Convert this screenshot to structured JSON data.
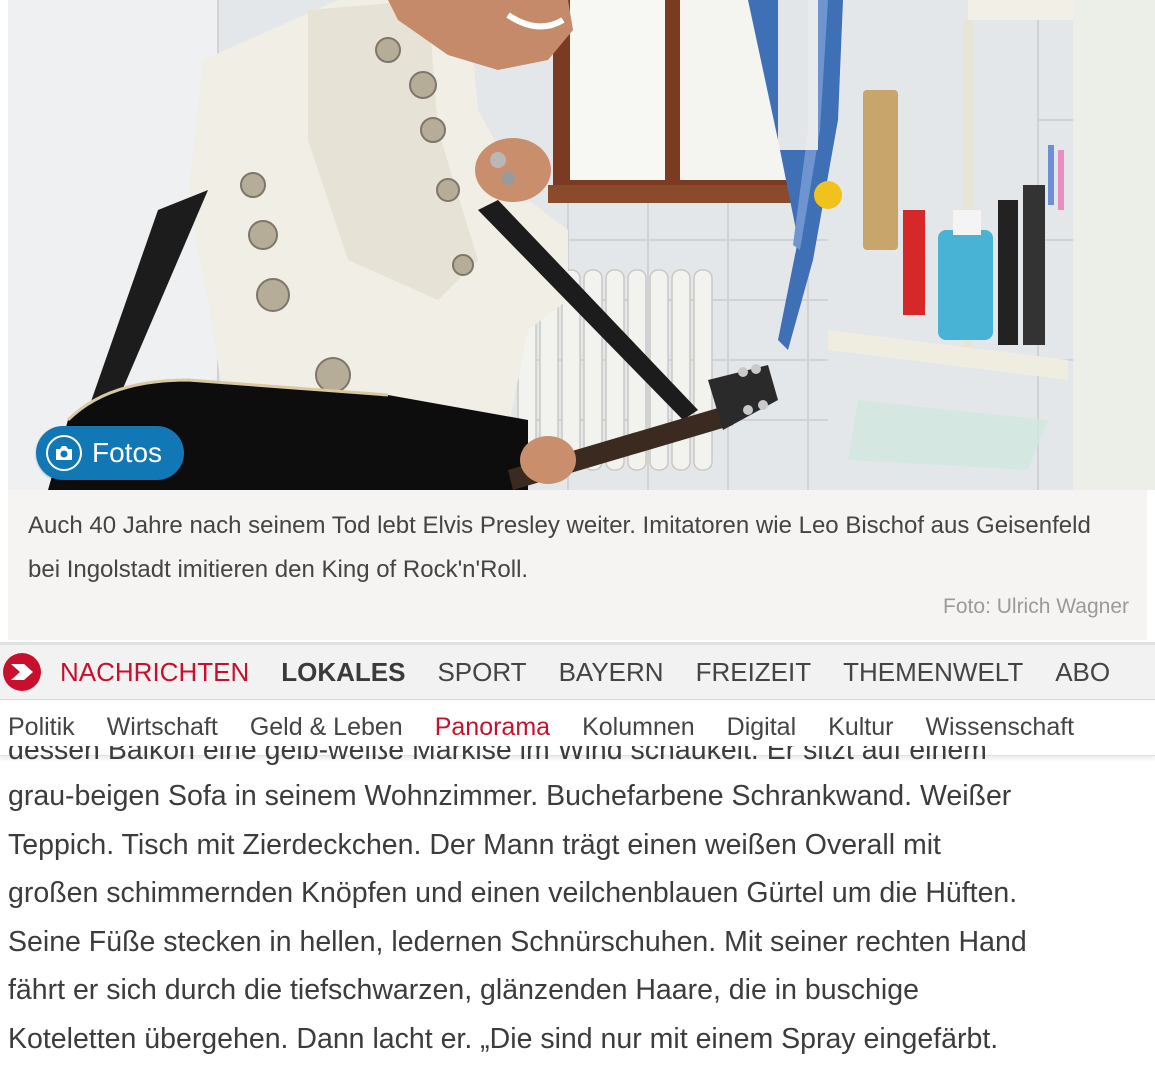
{
  "photo": {
    "alt_subject": "",
    "fotos_button_label": "Fotos",
    "icon": "camera-icon"
  },
  "caption": {
    "text": "Auch 40 Jahre nach seinem Tod lebt Elvis Presley weiter. Imitatoren wie Leo Bischof aus Geisenfeld bei Ingolstadt imitieren den King of Rock'n'Roll.",
    "credit": "Foto: Ulrich Wagner"
  },
  "nav_main": {
    "items": [
      {
        "label": "NACHRICHTEN",
        "state": "active"
      },
      {
        "label": "LOKALES",
        "state": "bold"
      },
      {
        "label": "SPORT",
        "state": ""
      },
      {
        "label": "BAYERN",
        "state": ""
      },
      {
        "label": "FREIZEIT",
        "state": ""
      },
      {
        "label": "THEMENWELT",
        "state": ""
      },
      {
        "label": "ABO",
        "state": ""
      }
    ],
    "logo_icon": "brand-arrow-logo-icon",
    "accent_color": "#c8102e"
  },
  "nav_sub": {
    "items": [
      {
        "label": "Politik",
        "state": ""
      },
      {
        "label": "Wirtschaft",
        "state": ""
      },
      {
        "label": "Geld & Leben",
        "state": ""
      },
      {
        "label": "Panorama",
        "state": "active"
      },
      {
        "label": "Kolumnen",
        "state": ""
      },
      {
        "label": "Digital",
        "state": ""
      },
      {
        "label": "Kultur",
        "state": ""
      },
      {
        "label": "Wissenschaft",
        "state": ""
      }
    ]
  },
  "article": {
    "partial_first_line": "dessen Balkon eine gelb-weiße Markise im Wind schaukelt. Er sitzt auf einem",
    "lines": [
      "grau-beigen Sofa in seinem Wohnzimmer. Buchefarbene Schrankwand. Weißer",
      "Teppich. Tisch mit Zierdeckchen. Der Mann trägt einen weißen Overall mit",
      "großen schimmernden Knöpfen und einen veilchenblauen Gürtel um die Hüften.",
      "Seine Füße stecken in hellen, ledernen Schnürschuhen. Mit seiner rechten Hand",
      "fährt er sich durch die tiefschwarzen, glänzenden Haare, die in buschige",
      "Koteletten übergehen. Dann lacht er. „Die sind nur mit einem Spray eingefärbt."
    ]
  }
}
